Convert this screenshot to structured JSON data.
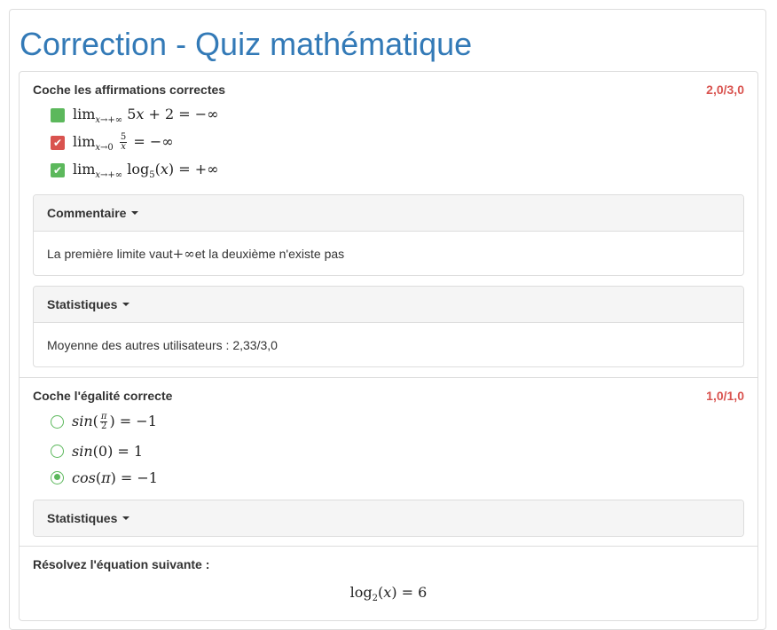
{
  "page": {
    "title": "Correction - Quiz mathématique"
  },
  "questions": [
    {
      "title": "Coche les affirmations correctes",
      "score": "2,0/3,0",
      "answers": [
        {
          "type": "checkbox",
          "mark": "green-filled",
          "expression": "lim x→+∞ 5x + 2 = −∞"
        },
        {
          "type": "checkbox",
          "mark": "red-check",
          "expression": "lim x→0 5/x = −∞"
        },
        {
          "type": "checkbox",
          "mark": "green-check",
          "expression": "lim x→+∞ log5(x) = +∞"
        }
      ],
      "comment": {
        "heading": "Commentaire",
        "text_before": "La première limite vaut ",
        "symbol": "+∞",
        "text_after": " et la deuxième n'existe pas"
      },
      "statistics": {
        "heading": "Statistiques",
        "text": "Moyenne des autres utilisateurs : 2,33/3,0"
      }
    },
    {
      "title": "Coche l'égalité correcte",
      "score": "1,0/1,0",
      "answers": [
        {
          "type": "radio",
          "checked": false,
          "expression": "sin(π/2) = −1"
        },
        {
          "type": "radio",
          "checked": false,
          "expression": "sin(0) = 1"
        },
        {
          "type": "radio",
          "checked": true,
          "expression": "cos(π) = −1"
        }
      ],
      "statistics": {
        "heading": "Statistiques"
      }
    },
    {
      "title": "Résolvez l'équation suivante :",
      "equation": "log2(x) = 6"
    }
  ],
  "colors": {
    "title": "#337ab7",
    "score": "#d9534f",
    "correct": "#5cb85c",
    "wrong": "#d9534f"
  }
}
